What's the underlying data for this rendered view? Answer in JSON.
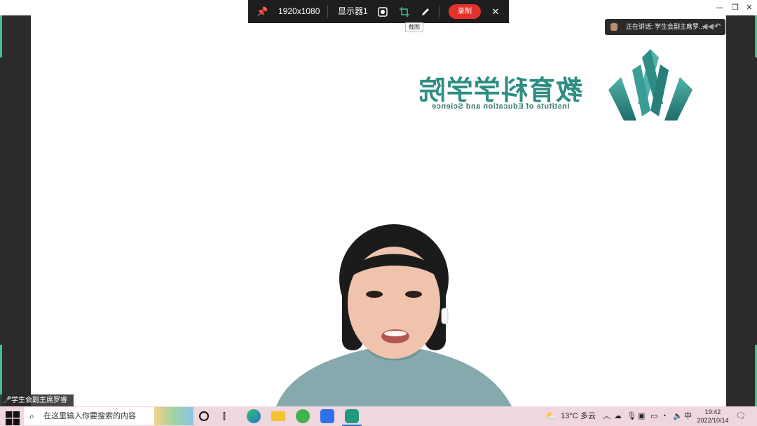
{
  "capture_toolbar": {
    "resolution": "1920x1080",
    "display": "显示器1",
    "record_label": "录制",
    "tooltip": "截图"
  },
  "speaking": {
    "text": "正在讲话: 学生会副主席罗..."
  },
  "logo": {
    "title": "教育科学学院",
    "subtitle": "Institute of Education and Science"
  },
  "participant": {
    "name": "学生会副主席罗睿馨"
  },
  "taskbar": {
    "search_placeholder": "在这里输入你要搜索的内容",
    "weather_temp": "13°C",
    "weather_desc": "多云",
    "ime": "中",
    "time": "19:42",
    "date": "2022/10/14"
  },
  "colors": {
    "accent_green": "#3cc391",
    "record_red": "#e3322c",
    "logo_teal": "#2f8d83",
    "taskbar_pink": "#f0d6de"
  }
}
